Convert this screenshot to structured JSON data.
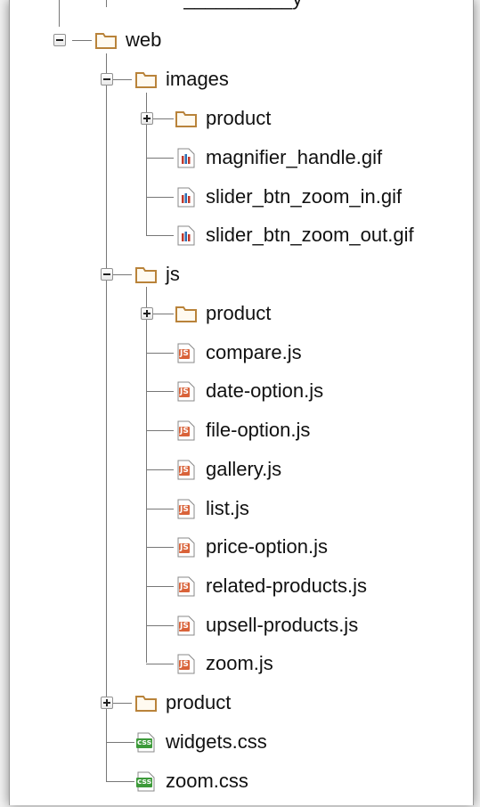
{
  "tree": {
    "top_partial_label": "__________y",
    "nodes": [
      {
        "id": "web",
        "label": "web",
        "type": "folder",
        "expander": "minus"
      },
      {
        "id": "images",
        "label": "images",
        "type": "folder",
        "expander": "minus"
      },
      {
        "id": "images-product",
        "label": "product",
        "type": "folder",
        "expander": "plus"
      },
      {
        "id": "magnifier",
        "label": "magnifier_handle.gif",
        "type": "gif"
      },
      {
        "id": "zoom-in",
        "label": "slider_btn_zoom_in.gif",
        "type": "gif"
      },
      {
        "id": "zoom-out",
        "label": "slider_btn_zoom_out.gif",
        "type": "gif"
      },
      {
        "id": "js",
        "label": "js",
        "type": "folder",
        "expander": "minus"
      },
      {
        "id": "js-product",
        "label": "product",
        "type": "folder",
        "expander": "plus"
      },
      {
        "id": "compare",
        "label": "compare.js",
        "type": "js"
      },
      {
        "id": "date-option",
        "label": "date-option.js",
        "type": "js"
      },
      {
        "id": "file-option",
        "label": "file-option.js",
        "type": "js"
      },
      {
        "id": "gallery",
        "label": "gallery.js",
        "type": "js"
      },
      {
        "id": "list",
        "label": "list.js",
        "type": "js"
      },
      {
        "id": "price-option",
        "label": "price-option.js",
        "type": "js"
      },
      {
        "id": "related-products",
        "label": "related-products.js",
        "type": "js"
      },
      {
        "id": "upsell-products",
        "label": "upsell-products.js",
        "type": "js"
      },
      {
        "id": "zoom-js",
        "label": "zoom.js",
        "type": "js"
      },
      {
        "id": "web-product",
        "label": "product",
        "type": "folder",
        "expander": "plus"
      },
      {
        "id": "widgets-css",
        "label": "widgets.css",
        "type": "css"
      },
      {
        "id": "zoom-css",
        "label": "zoom.css",
        "type": "css"
      }
    ],
    "icon_badges": {
      "js": "JS",
      "css": "css"
    }
  },
  "colors": {
    "folder": "#b9833a",
    "js_badge": "#d9633a",
    "css_badge": "#3d9a3a",
    "gif_bar": "#c0392b"
  }
}
